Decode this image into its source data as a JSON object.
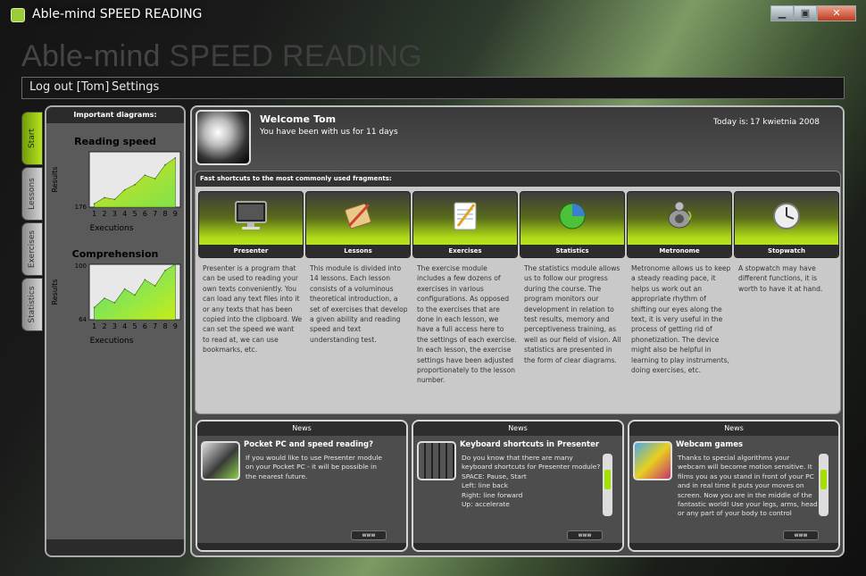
{
  "window": {
    "title": "Able-mind SPEED READING",
    "big_title_a": "Able-mind",
    "big_title_b": "SPEED READING",
    "minimize": "▁",
    "maximize": "▣",
    "close": "✕"
  },
  "menu": {
    "logout": "Log out",
    "user": "[Tom]",
    "settings": "Settings"
  },
  "tabs": [
    "Start",
    "Lessons",
    "Exercises",
    "Statistics"
  ],
  "left_panel": {
    "header": "Important diagrams:"
  },
  "chart_data": [
    {
      "type": "area",
      "title": "Reading speed",
      "xlabel": "Executions",
      "ylabel": "Results",
      "x": [
        1,
        2,
        3,
        4,
        5,
        6,
        7,
        8,
        9
      ],
      "values": [
        180,
        187,
        185,
        196,
        202,
        213,
        209,
        225,
        233
      ],
      "ylim": [
        176,
        240
      ],
      "ytick_label": "176",
      "fill": [
        "#d9e21a",
        "#7fe24a"
      ]
    },
    {
      "type": "area",
      "title": "Comprehension",
      "xlabel": "Executions",
      "ylabel": "Results",
      "x": [
        1,
        2,
        3,
        4,
        5,
        6,
        7,
        8,
        9
      ],
      "values": [
        72,
        78,
        75,
        84,
        80,
        90,
        86,
        96,
        100
      ],
      "ylim": [
        64,
        100
      ],
      "ytick_low": "64",
      "ytick_high": "100",
      "fill": [
        "#4fe080",
        "#c6ec1a"
      ]
    }
  ],
  "welcome": {
    "label": "Welcome",
    "user": "Tom",
    "days": "You have been with us for 11 days",
    "today_label": "Today is:",
    "today_date": "17 kwietnia 2008"
  },
  "shortcuts": {
    "header": "Fast shortcuts to the most commonly used fragments:",
    "items": [
      {
        "label": "Presenter",
        "icon": "monitor-icon",
        "desc": "Presenter is a program that can be used to reading your own texts conveniently. You can load any text files into it or any texts that has been copied into the clipboard. We can set the speed we want to read at, we can use bookmarks, etc."
      },
      {
        "label": "Lessons",
        "icon": "book-pen-icon",
        "desc": "This module is divided into 14 lessons. Each lesson consists of a voluminous theoretical introduction, a set of exercises that develop a given ability and reading speed and text understanding test."
      },
      {
        "label": "Exercises",
        "icon": "notepad-icon",
        "desc": "The exercise module includes a few dozens of exercises in various configurations. As opposed to the exercises that are done in each lesson, we have a full access here to the settings of each exercise. In each lesson, the exercise settings have been adjusted proportionately to the lesson number."
      },
      {
        "label": "Statistics",
        "icon": "pie-chart-icon",
        "desc": "The statistics module allows us to follow our progress during the course. The program monitors our development in relation to test results, memory and perceptiveness training, as well as our field of vision. All statistics are presented in the form of clear diagrams."
      },
      {
        "label": "Metronome",
        "icon": "speaker-icon",
        "desc": "Metronome allows us to keep a steady reading pace, it helps us work out an appropriate rhythm of shifting our eyes along the text, it is very useful in the process of getting rid of phonetization. The device might also be helpful in learning to play instruments, doing exercises, etc."
      },
      {
        "label": "Stopwatch",
        "icon": "clock-icon",
        "desc": "A stopwatch may have different functions, it is worth to have it at hand."
      }
    ]
  },
  "news": [
    {
      "header": "News",
      "title": "Pocket PC and speed reading?",
      "icon": "pda-icon",
      "body": "If you would like to use Presenter module on your Pocket PC - it will be possible in the nearest future.",
      "www": "www",
      "scroll": false
    },
    {
      "header": "News",
      "title": "Keyboard shortcuts in Presenter",
      "icon": "keyboard-icon",
      "body": "Do you know that there are many keyboard shortcuts for Presenter module?\nSPACE: Pause, Start\nLeft: line back\nRight: line forward\nUp: accelerate",
      "www": "www",
      "scroll": true
    },
    {
      "header": "News",
      "title": "Webcam games",
      "icon": "webcam-photo-icon",
      "body": "Thanks to special algorithms your webcam will become motion sensitive. It films you as you stand in front of your PC and in real time it puts your moves on screen. Now you are in the middle of the fantastic world! Use your legs, arms, head or any part of your body to control",
      "www": "www",
      "scroll": true
    }
  ]
}
